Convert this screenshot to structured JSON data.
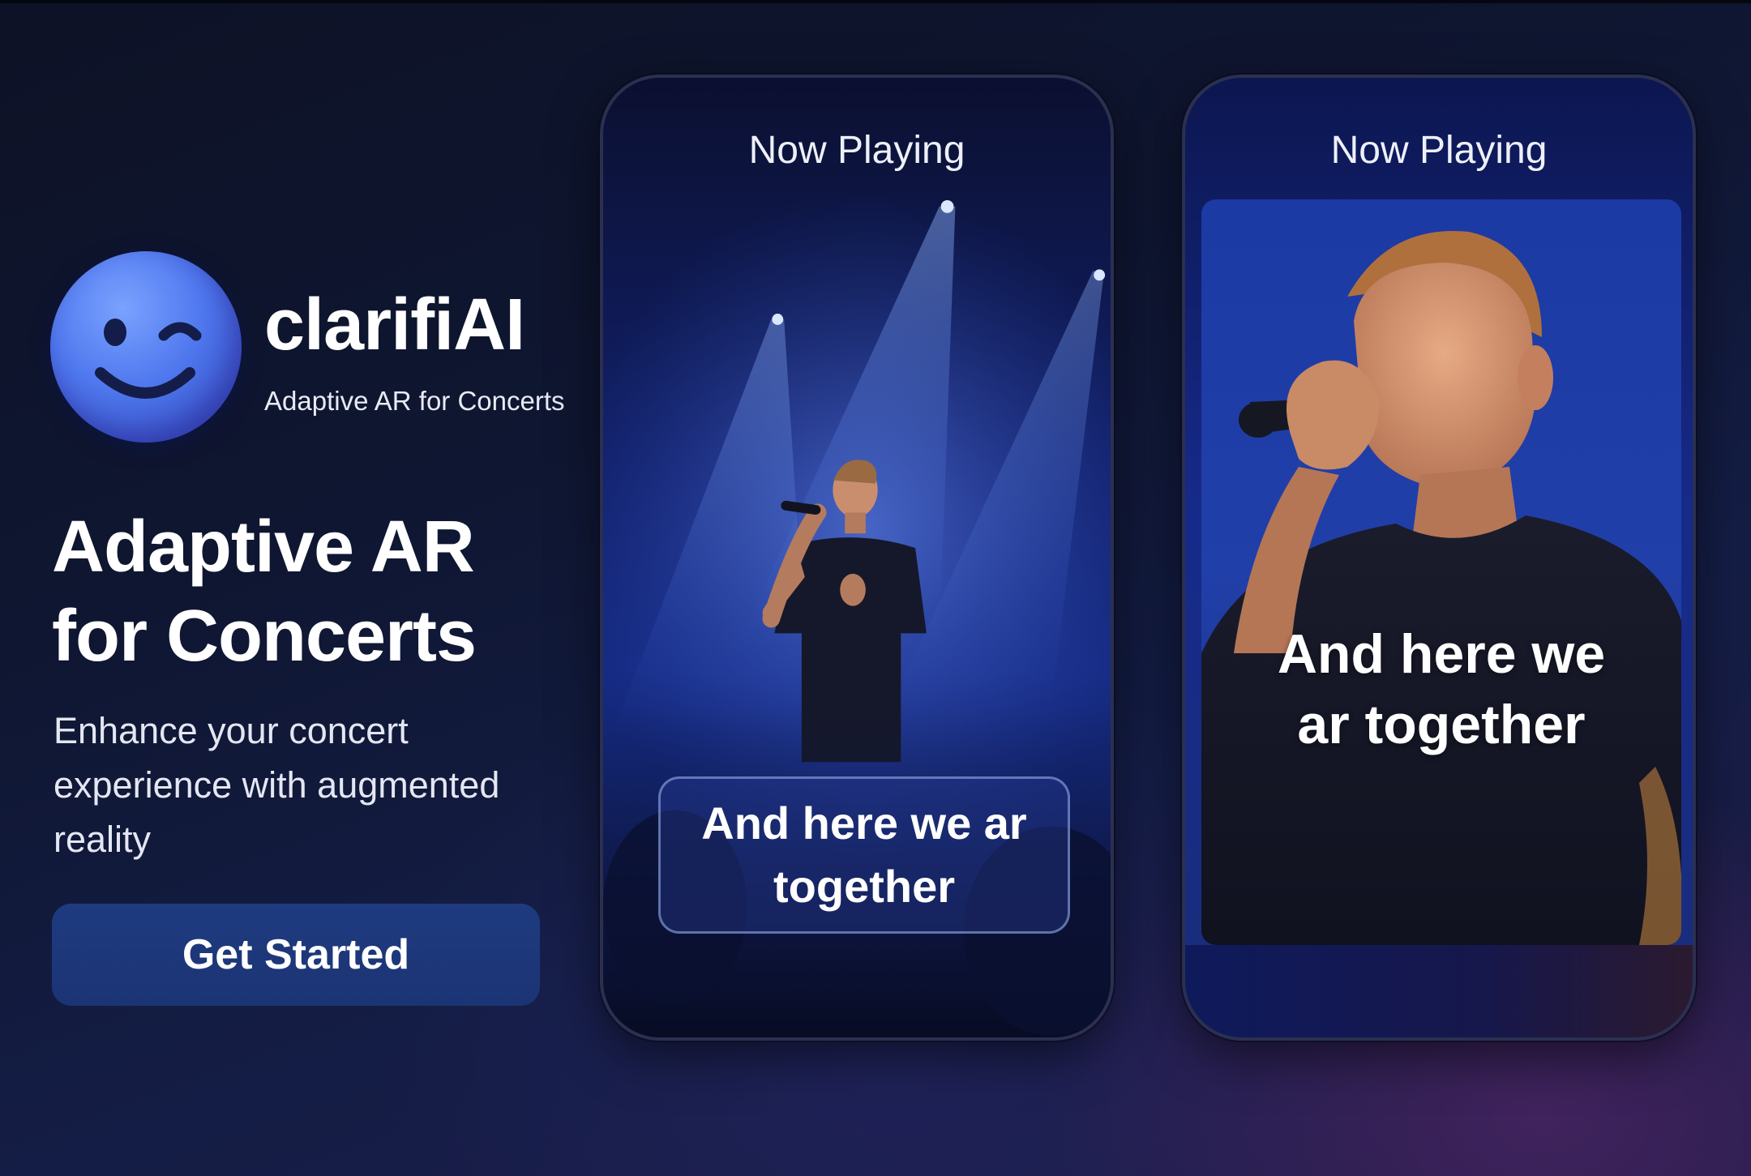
{
  "brand": {
    "name": "clarifiAI",
    "tagline": "Adaptive AR for Concerts",
    "logo_icon": "winking-face-icon"
  },
  "hero": {
    "heading": "Adaptive AR for Concerts",
    "body": "Enhance your concert experience with augmented reality"
  },
  "cta": {
    "label": "Get Started"
  },
  "phones": [
    {
      "title": "Now Playing",
      "lyric": "And here we ar together",
      "scene": "singer-on-stage-image"
    },
    {
      "title": "Now Playing",
      "lyric": "And here we ar together",
      "scene": "singer-closeup-image"
    }
  ],
  "colors": {
    "background": "#0f1631",
    "accent": "#4f77ee",
    "button": "#1d3779",
    "phone_border": "#2b3050"
  }
}
